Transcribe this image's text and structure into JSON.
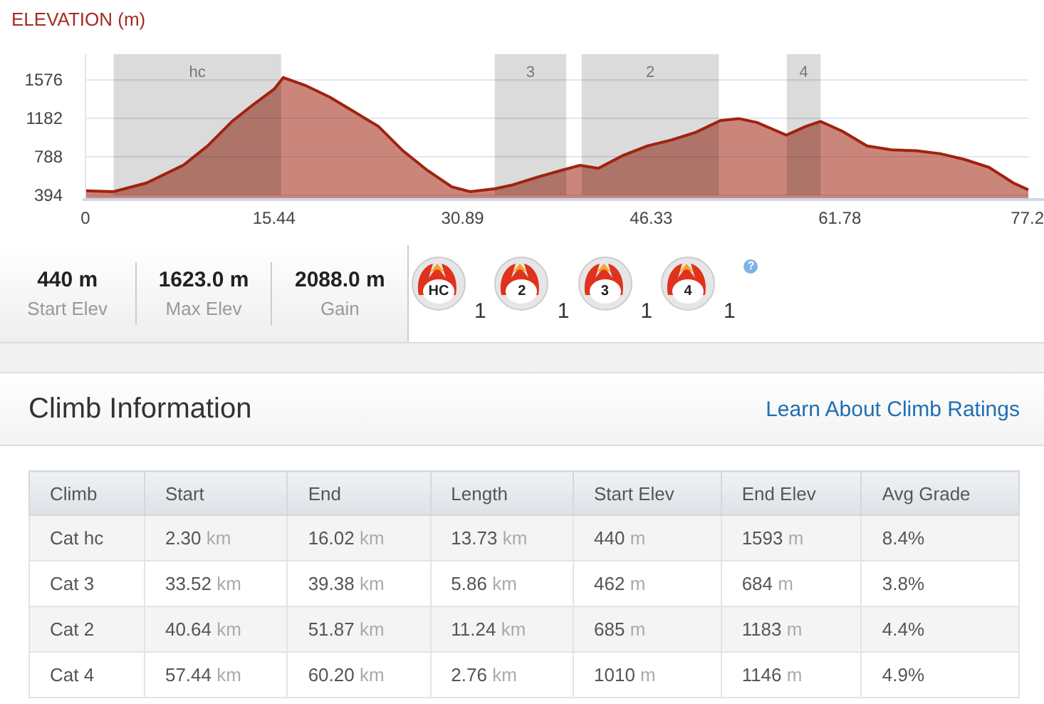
{
  "elevation_chart": {
    "chart_data": {
      "type": "area",
      "title": "ELEVATION (m)",
      "x": [
        0,
        2.3,
        5,
        8,
        10,
        12,
        13.5,
        15.44,
        16.2,
        18,
        20,
        22,
        24,
        26,
        28,
        30,
        31.5,
        33.5,
        35,
        37,
        39,
        40.5,
        42,
        44,
        46,
        48,
        50,
        52,
        53.5,
        55,
        57.4,
        59,
        60.2,
        62,
        64,
        66,
        68,
        70,
        72,
        74,
        76,
        77.22
      ],
      "series": [
        {
          "color": "#a0220f",
          "values": [
            440,
            430,
            520,
            700,
            900,
            1150,
            1300,
            1480,
            1600,
            1520,
            1400,
            1250,
            1100,
            850,
            650,
            480,
            430,
            460,
            500,
            580,
            650,
            700,
            670,
            800,
            900,
            960,
            1040,
            1160,
            1180,
            1140,
            1010,
            1100,
            1150,
            1050,
            900,
            860,
            850,
            820,
            760,
            680,
            520,
            450
          ]
        }
      ],
      "xlim": [
        0,
        77.22
      ],
      "ylim": [
        394,
        1840
      ],
      "grid": true,
      "xticks": [
        0,
        15.44,
        30.89,
        46.33,
        61.78,
        {
          "value": 77.22,
          "label": "77.2"
        }
      ],
      "yticks": [
        394,
        788,
        1182,
        1576
      ],
      "bands": [
        {
          "axis": "x",
          "label": "hc",
          "from": 2.3,
          "to": 16.02
        },
        {
          "axis": "x",
          "label": "3",
          "from": 33.52,
          "to": 39.38
        },
        {
          "axis": "x",
          "label": "2",
          "from": 40.64,
          "to": 51.87
        },
        {
          "axis": "x",
          "label": "4",
          "from": 57.44,
          "to": 60.2
        }
      ]
    }
  },
  "stats": [
    {
      "value": "440 m",
      "label": "Start Elev"
    },
    {
      "value": "1623.0 m",
      "label": "Max Elev"
    },
    {
      "value": "2088.0 m",
      "label": "Gain"
    }
  ],
  "climb_badges": [
    {
      "category": "HC",
      "count": "1"
    },
    {
      "category": "2",
      "count": "1"
    },
    {
      "category": "3",
      "count": "1"
    },
    {
      "category": "4",
      "count": "1"
    }
  ],
  "help": "?",
  "section": {
    "title": "Climb Information",
    "link": "Learn About Climb Ratings"
  },
  "table": {
    "columns": [
      "Climb",
      "Start",
      "End",
      "Length",
      "Start Elev",
      "End Elev",
      "Avg Grade"
    ],
    "rows": [
      [
        {
          "value": "Cat hc"
        },
        {
          "value": "2.30",
          "unit": "km"
        },
        {
          "value": "16.02",
          "unit": "km"
        },
        {
          "value": "13.73",
          "unit": "km"
        },
        {
          "value": "440",
          "unit": "m"
        },
        {
          "value": "1593",
          "unit": "m"
        },
        {
          "value": "8.4%"
        }
      ],
      [
        {
          "value": "Cat 3"
        },
        {
          "value": "33.52",
          "unit": "km"
        },
        {
          "value": "39.38",
          "unit": "km"
        },
        {
          "value": "5.86",
          "unit": "km"
        },
        {
          "value": "462",
          "unit": "m"
        },
        {
          "value": "684",
          "unit": "m"
        },
        {
          "value": "3.8%"
        }
      ],
      [
        {
          "value": "Cat 2"
        },
        {
          "value": "40.64",
          "unit": "km"
        },
        {
          "value": "51.87",
          "unit": "km"
        },
        {
          "value": "11.24",
          "unit": "km"
        },
        {
          "value": "685",
          "unit": "m"
        },
        {
          "value": "1183",
          "unit": "m"
        },
        {
          "value": "4.4%"
        }
      ],
      [
        {
          "value": "Cat 4"
        },
        {
          "value": "57.44",
          "unit": "km"
        },
        {
          "value": "60.20",
          "unit": "km"
        },
        {
          "value": "2.76",
          "unit": "km"
        },
        {
          "value": "1010",
          "unit": "m"
        },
        {
          "value": "1146",
          "unit": "m"
        },
        {
          "value": "4.9%"
        }
      ]
    ]
  }
}
